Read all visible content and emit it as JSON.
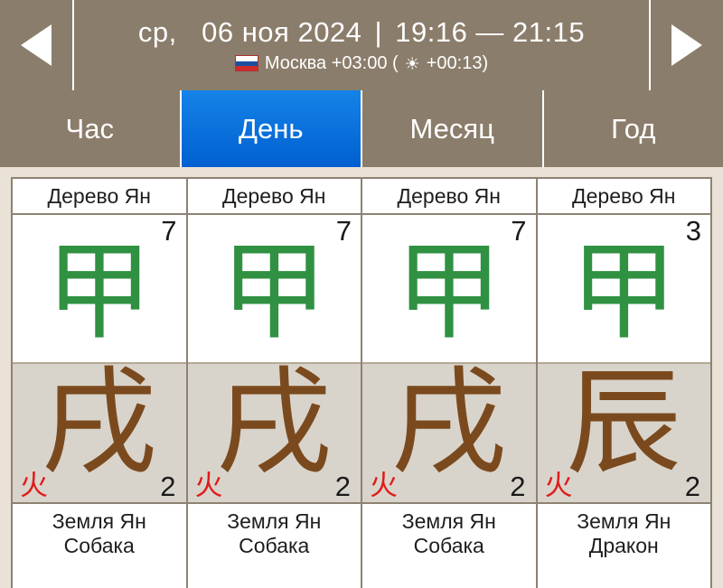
{
  "header": {
    "prev_icon": "triangle-left-icon",
    "next_icon": "triangle-right-icon",
    "weekday": "ср,",
    "date": "06 ноя 2024",
    "separator": "|",
    "time_range": "19:16 — 21:15",
    "flag_icon": "russia-flag-icon",
    "location": "Москва +03:00 (",
    "sun_icon": "☀",
    "solar_offset": " +00:13)",
    "line1_full": "ср,  06 ноя 2024 | 19:16 — 21:15",
    "line2_full": "Москва +03:00 (☀ +00:13)"
  },
  "tabs": [
    {
      "label": "Час",
      "active": false
    },
    {
      "label": "День",
      "active": true
    },
    {
      "label": "Месяц",
      "active": false
    },
    {
      "label": "Год",
      "active": false
    }
  ],
  "colors": {
    "chrome_brown": "#8b7d6b",
    "active_tab_blue": "#0d7ee3",
    "page_cream": "#eae2d6",
    "grid_border": "#8d8273",
    "stem_green": "#2f9141",
    "branch_brown": "#7a4a1e",
    "element_red": "#e01b1b",
    "branch_cell_gray": "#d9d4cb"
  },
  "columns": [
    {
      "stem_label": "Дерево Ян",
      "stem_number": "7",
      "stem_glyph": "甲",
      "branch_glyph": "戌",
      "branch_element_glyph": "火",
      "branch_number": "2",
      "branch_label_line1": "Земля Ян",
      "branch_label_line2": "Собака"
    },
    {
      "stem_label": "Дерево Ян",
      "stem_number": "7",
      "stem_glyph": "甲",
      "branch_glyph": "戌",
      "branch_element_glyph": "火",
      "branch_number": "2",
      "branch_label_line1": "Земля Ян",
      "branch_label_line2": "Собака"
    },
    {
      "stem_label": "Дерево Ян",
      "stem_number": "7",
      "stem_glyph": "甲",
      "branch_glyph": "戌",
      "branch_element_glyph": "火",
      "branch_number": "2",
      "branch_label_line1": "Земля Ян",
      "branch_label_line2": "Собака"
    },
    {
      "stem_label": "Дерево Ян",
      "stem_number": "3",
      "stem_glyph": "甲",
      "branch_glyph": "辰",
      "branch_element_glyph": "火",
      "branch_number": "2",
      "branch_label_line1": "Земля Ян",
      "branch_label_line2": "Дракон"
    }
  ]
}
